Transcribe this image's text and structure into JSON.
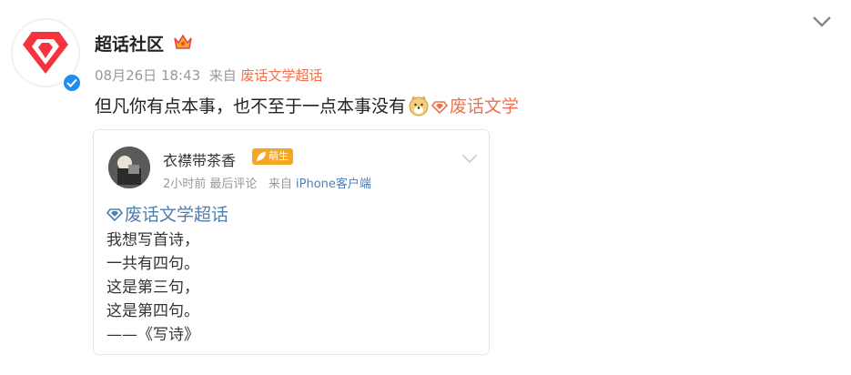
{
  "post": {
    "author": "超话社区",
    "time": "08月26日 18:43",
    "from_prefix": "来自",
    "source": "废话文学超话",
    "text": "但凡你有点本事，也不至于一点本事没有",
    "topic": "废话文学"
  },
  "card": {
    "author": "衣襟带茶香",
    "badge": "萌生",
    "time_ago": "2小时前",
    "last_comment": "最后评论",
    "from_prefix": "来自",
    "device": "iPhone客户端",
    "topic": "废话文学超话",
    "lines": [
      "我想写首诗，",
      "一共有四句。",
      "这是第三句，",
      "这是第四句。",
      "——《写诗》"
    ]
  },
  "colors": {
    "accent_orange": "#eb7350",
    "link_blue": "#507daf",
    "verified_blue": "#1f8ef1"
  },
  "icons": {
    "avatar": "super-topic-diamond-logo",
    "verified": "verified-check-icon",
    "crown": "crown-icon",
    "expand": "chevron-down-icon",
    "emoji": "doge-emoji-icon",
    "topic": "super-topic-icon"
  }
}
